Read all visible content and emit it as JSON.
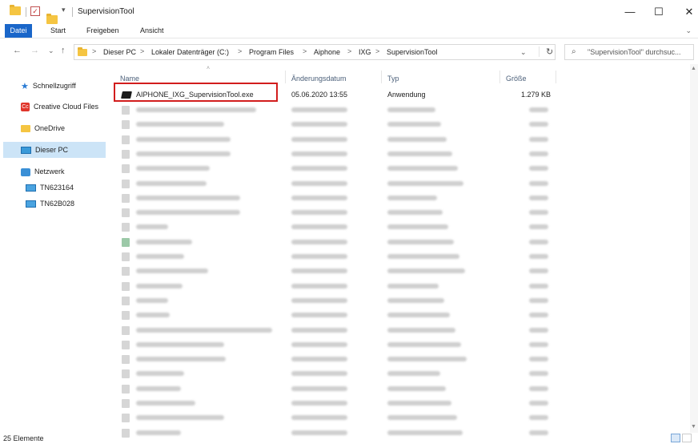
{
  "window": {
    "title": "SupervisionTool",
    "qa_glyph": "▾",
    "minimize": "—",
    "maximize": "☐",
    "close": "✕"
  },
  "ribbon": {
    "tabs": [
      "Datei",
      "Start",
      "Freigeben",
      "Ansicht"
    ],
    "collapse_glyph": "⌄"
  },
  "address": {
    "back": "←",
    "forward": "→",
    "recent": "⌄",
    "up": "↑",
    "crumbs": [
      "Dieser PC",
      "Lokaler Datenträger (C:)",
      "Program Files",
      "Aiphone",
      "IXG",
      "SupervisionTool"
    ],
    "separator": ">",
    "dropdown": "⌄",
    "refresh": "↻"
  },
  "search": {
    "icon": "⌕",
    "placeholder": "\"SupervisionTool\" durchsuc..."
  },
  "nav": [
    {
      "label": "Schnellzugriff",
      "icon": "star-icon"
    },
    {
      "label": "Creative Cloud Files",
      "icon": "creative-cloud-icon",
      "badge": "Cc"
    },
    {
      "label": "OneDrive",
      "icon": "folder-icon"
    },
    {
      "label": "Dieser PC",
      "icon": "pc-icon",
      "selected": true
    },
    {
      "label": "Netzwerk",
      "icon": "network-icon"
    },
    {
      "label": "TN623164",
      "icon": "computer-icon"
    },
    {
      "label": "TN62B028",
      "icon": "computer-icon"
    }
  ],
  "columns": {
    "name": "Name",
    "date": "Änderungsdatum",
    "type": "Typ",
    "size": "Größe",
    "sort_glyph": "˄"
  },
  "files": [
    {
      "name": "AIPHONE_IXG_SupervisionTool.exe",
      "date": "05.06.2020 13:55",
      "type": "Anwendung",
      "size": "1.279 KB"
    }
  ],
  "scroll": {
    "up": "▲",
    "down": "▼"
  },
  "status": {
    "count": "25 Elemente"
  }
}
